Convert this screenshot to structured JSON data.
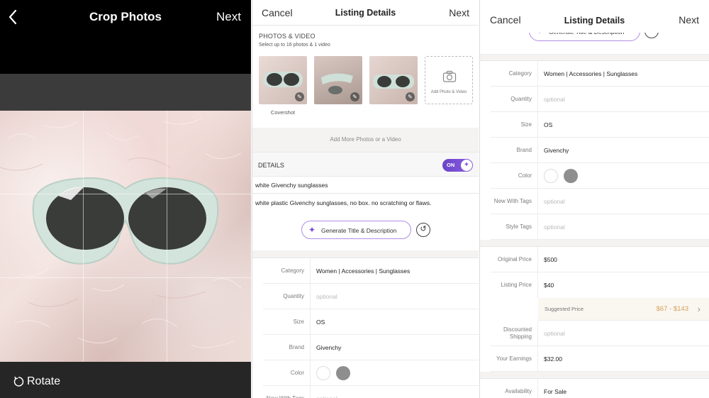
{
  "crop": {
    "title": "Crop Photos",
    "next": "Next",
    "rotate": "Rotate"
  },
  "listing": {
    "cancel": "Cancel",
    "title": "Listing Details",
    "next": "Next",
    "photos_label": "PHOTOS & VIDEO",
    "photos_sub": "Select up to 16 photos & 1 video",
    "add_photo": "Add Photo & Video",
    "covershot": "Covershot",
    "add_more": "Add More Photos or a Video",
    "details_label": "DETAILS",
    "toggle_on": "ON",
    "item_title": "white Givenchy sunglasses",
    "item_desc": "white plastic Givenchy sunglasses, no box. no scratching or flaws.",
    "generate": "Generate Title & Description",
    "fields": [
      {
        "label": "Category",
        "value": "Women | Accessories | Sunglasses",
        "placeholder": false
      },
      {
        "label": "Quantity",
        "value": "optional",
        "placeholder": true
      },
      {
        "label": "Size",
        "value": "OS",
        "placeholder": false
      },
      {
        "label": "Brand",
        "value": "Givenchy",
        "placeholder": false
      },
      {
        "label": "Color",
        "value": "",
        "placeholder": false
      },
      {
        "label": "New With Tags",
        "value": "optional",
        "placeholder": true
      }
    ]
  },
  "details2": {
    "cancel": "Cancel",
    "title": "Listing Details",
    "next": "Next",
    "generate": "Generate Title & Description",
    "fields": [
      {
        "label": "Category",
        "value": "Women | Accessories | Sunglasses",
        "placeholder": false
      },
      {
        "label": "Quantity",
        "value": "optional",
        "placeholder": true
      },
      {
        "label": "Size",
        "value": "OS",
        "placeholder": false
      },
      {
        "label": "Brand",
        "value": "Givenchy",
        "placeholder": false
      },
      {
        "label": "Color",
        "value": "",
        "placeholder": false
      },
      {
        "label": "New With Tags",
        "value": "optional",
        "placeholder": true
      },
      {
        "label": "Style Tags",
        "value": "optional",
        "placeholder": true
      }
    ],
    "price_fields": [
      {
        "label": "Original Price",
        "value": "$500",
        "placeholder": false
      },
      {
        "label": "Listing Price",
        "value": "$40",
        "placeholder": false
      }
    ],
    "suggested_label": "Suggested Price",
    "suggested_value": "$67 - $143",
    "shipping": {
      "label": "Discounted Shipping",
      "value": "optional"
    },
    "earnings": {
      "label": "Your Earnings",
      "value": "$32.00"
    },
    "availability": {
      "label": "Availability",
      "value": "For Sale"
    }
  },
  "colors": {
    "accent": "#7a4fd6",
    "suggested": "#d4a25a",
    "swatch_white": "#ffffff",
    "swatch_grey": "#8e8e8e"
  }
}
